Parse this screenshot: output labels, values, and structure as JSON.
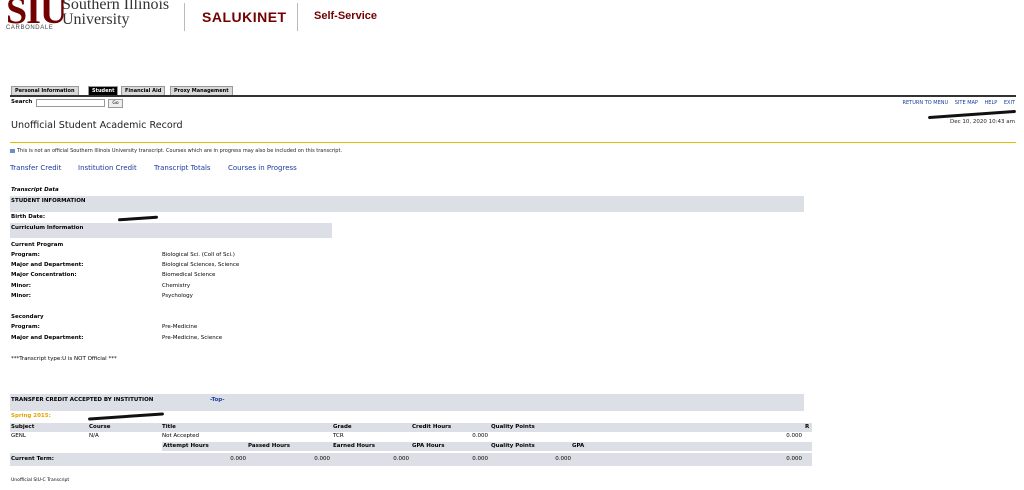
{
  "header": {
    "siu_logo": "SIU",
    "university_line1": "Southern Illinois",
    "university_line2": "University",
    "campus": "CARBONDALE",
    "salukinet": "SALUKINET",
    "self_service": "Self-Service"
  },
  "tabs": [
    "Personal Information",
    "Student",
    "Financial Aid",
    "Proxy Management"
  ],
  "active_tab": "Student",
  "search": {
    "label": "Search",
    "value": "",
    "go_label": "Go"
  },
  "top_links": [
    "RETURN TO MENU",
    "SITE MAP",
    "HELP",
    "EXIT"
  ],
  "timestamp": "Dec 10, 2020 10:43 am",
  "page_title": "Unofficial Student Academic Record",
  "info_notice": "This is not an official Southern Illinois University transcript. Courses which are in progress may also be included on this transcript.",
  "section_links": [
    "Transfer Credit",
    "Institution Credit",
    "Transcript Totals",
    "Courses in Progress"
  ],
  "transcript": {
    "caption": "Transcript Data",
    "student_info_header": "STUDENT INFORMATION",
    "birth_date_label": "Birth Date:",
    "curriculum_header": "Curriculum Information",
    "current_program_header": "Current Program",
    "current": [
      {
        "label": "Program:",
        "value": "Biological Sci. (Coll of Sci.)"
      },
      {
        "label": "Major and Department:",
        "value": "Biological Sciences, Science"
      },
      {
        "label": "Major Concentration:",
        "value": "Biomedical Science"
      },
      {
        "label": "Minor:",
        "value": "Chemistry"
      },
      {
        "label": "Minor:",
        "value": "Psychology"
      }
    ],
    "secondary_header": "Secondary",
    "secondary": [
      {
        "label": "Program:",
        "value": "Pre-Medicine"
      },
      {
        "label": "Major and Department:",
        "value": "Pre-Medicine, Science"
      }
    ],
    "type_note": "***Transcript type:U is NOT Official ***"
  },
  "transfer": {
    "header": "TRANSFER CREDIT ACCEPTED BY INSTITUTION",
    "top_link": "-Top-",
    "term": "Spring 2015:",
    "columns": [
      "Subject",
      "Course",
      "Title",
      "Grade",
      "Credit Hours",
      "Quality Points",
      "R"
    ],
    "row": {
      "subject": "GENL",
      "course": "N/A",
      "title": "Not Accepted",
      "grade": "TCR",
      "credit_hours": "0.000",
      "quality_points": "0.000"
    },
    "totals_columns": [
      "Attempt Hours",
      "Passed Hours",
      "Earned Hours",
      "GPA Hours",
      "Quality Points",
      "GPA"
    ],
    "current_term_label": "Current Term:",
    "current_term_values": [
      "0.000",
      "0.000",
      "0.000",
      "0.000",
      "0.000",
      "0.000"
    ]
  },
  "footer": "Unofficial SIU-C Transcript"
}
